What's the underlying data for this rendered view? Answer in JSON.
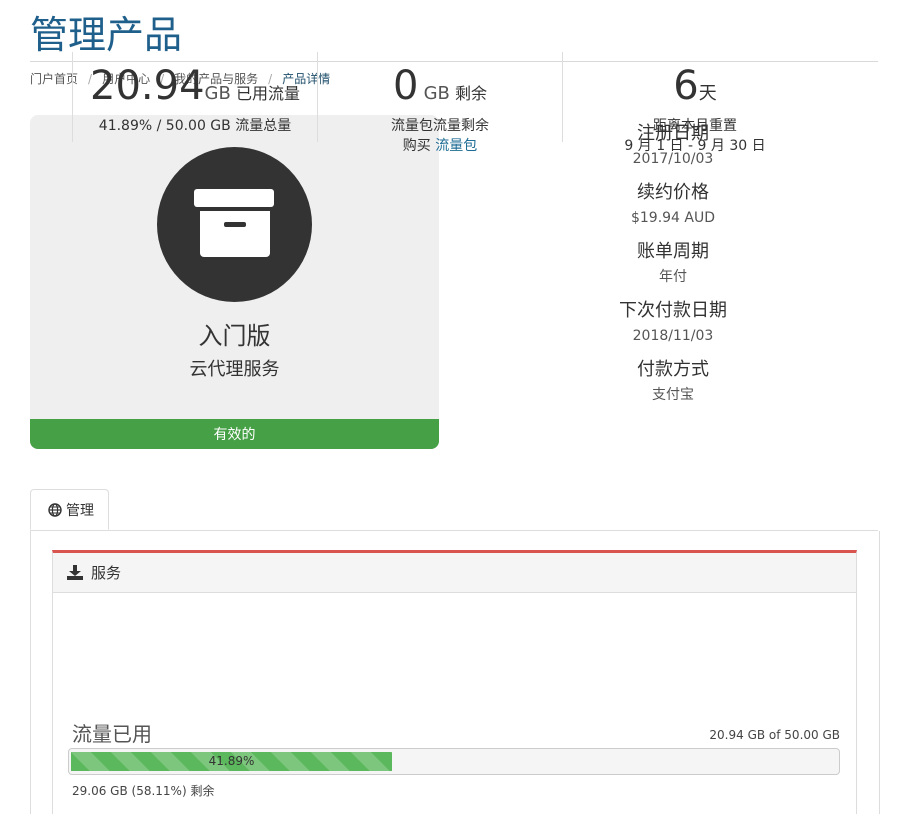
{
  "page": {
    "title": "管理产品"
  },
  "breadcrumb": {
    "items": [
      "门户首页",
      "用户中心",
      "我的产品与服务"
    ],
    "active": "产品详情",
    "sep": "/"
  },
  "product": {
    "name": "入门版",
    "group": "云代理服务",
    "status": "有效的",
    "icon": "archive-box-icon"
  },
  "info": [
    {
      "label": "注册日期",
      "value": "2017/10/03"
    },
    {
      "label": "续约价格",
      "value": "$19.94 AUD"
    },
    {
      "label": "账单周期",
      "value": "年付"
    },
    {
      "label": "下次付款日期",
      "value": "2018/11/03"
    },
    {
      "label": "付款方式",
      "value": "支付宝"
    }
  ],
  "tabs": {
    "manage": "管理"
  },
  "panel": {
    "title": "服务",
    "used": {
      "value": "20.94",
      "unit": "GB",
      "label": "已用流量",
      "sub": "41.89% / 50.00 GB 流量总量"
    },
    "remaining": {
      "value": "0",
      "unit": "GB",
      "label": "剩余",
      "sub": "流量包流量剩余",
      "buy": "购买",
      "buy_link": "流量包"
    },
    "reset": {
      "value": "6",
      "unit": "天",
      "label": "距离本月重置",
      "sub": "9 月 1 日 - 9 月 30 日"
    }
  },
  "usage": {
    "title": "流量已用",
    "summary": "20.94 GB of 50.00 GB",
    "percent_label": "41.89%",
    "percent": 41.89,
    "remaining_text": "29.06 GB (58.11%) 剩余"
  },
  "colors": {
    "accent": "#1f5f8b",
    "status": "#46a046",
    "panel_top": "#d9534f",
    "progress": "#5cb85c"
  }
}
